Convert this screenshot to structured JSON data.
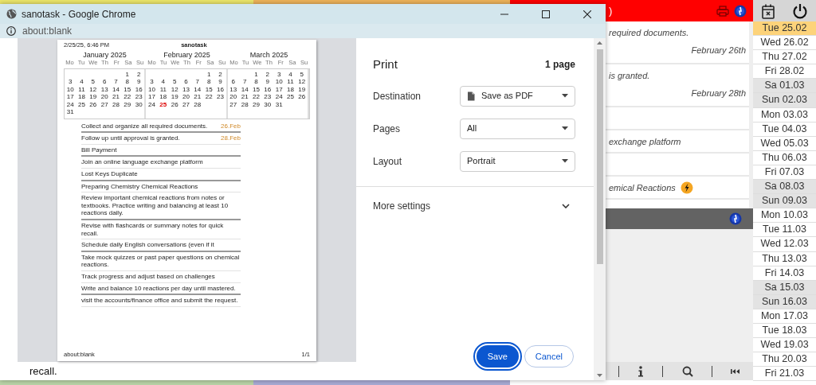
{
  "chrome_window": {
    "title": "sanotask - Google Chrome",
    "address": "about:blank"
  },
  "print_preview": {
    "header_left": "2/25/25, 6:46 PM",
    "header_center": "sanotask",
    "months": [
      {
        "title": "January 2025",
        "weekdays": [
          "Mo",
          "Tu",
          "We",
          "Th",
          "Fr",
          "Sa",
          "Su"
        ],
        "weeks": [
          {
            "right_aligned": true,
            "days": [
              {
                "day": "1",
                "today": false
              },
              {
                "day": "2",
                "today": false
              }
            ]
          },
          {
            "days": [
              {
                "day": "3",
                "today": false
              },
              {
                "day": "4",
                "today": false
              },
              {
                "day": "5",
                "today": false
              },
              {
                "day": "6",
                "today": false
              },
              {
                "day": "7",
                "today": false
              },
              {
                "day": "8",
                "today": false
              },
              {
                "day": "9",
                "today": false
              }
            ]
          },
          {
            "days": [
              {
                "day": "10",
                "today": false
              },
              {
                "day": "11",
                "today": false
              },
              {
                "day": "12",
                "today": false
              },
              {
                "day": "13",
                "today": false
              },
              {
                "day": "14",
                "today": false
              },
              {
                "day": "15",
                "today": false
              },
              {
                "day": "16",
                "today": false
              }
            ]
          },
          {
            "days": [
              {
                "day": "17",
                "today": false
              },
              {
                "day": "18",
                "today": false
              },
              {
                "day": "19",
                "today": false
              },
              {
                "day": "20",
                "today": false
              },
              {
                "day": "21",
                "today": false
              },
              {
                "day": "22",
                "today": false
              },
              {
                "day": "23",
                "today": false
              }
            ]
          },
          {
            "days": [
              {
                "day": "24",
                "today": false
              },
              {
                "day": "25",
                "today": false
              },
              {
                "day": "26",
                "today": false
              },
              {
                "day": "27",
                "today": false
              },
              {
                "day": "28",
                "today": false
              },
              {
                "day": "29",
                "today": false
              },
              {
                "day": "30",
                "today": false
              }
            ]
          },
          {
            "right_aligned": false,
            "days": [
              {
                "day": "31",
                "today": false
              }
            ]
          }
        ]
      },
      {
        "title": "February 2025",
        "weekdays": [
          "Mo",
          "Tu",
          "We",
          "Th",
          "Fr",
          "Sa",
          "Su"
        ],
        "weeks": [
          {
            "right_aligned": true,
            "days": [
              {
                "day": "1",
                "today": false
              },
              {
                "day": "2",
                "today": false
              }
            ]
          },
          {
            "days": [
              {
                "day": "3",
                "today": false
              },
              {
                "day": "4",
                "today": false
              },
              {
                "day": "5",
                "today": false
              },
              {
                "day": "6",
                "today": false
              },
              {
                "day": "7",
                "today": false
              },
              {
                "day": "8",
                "today": false
              },
              {
                "day": "9",
                "today": false
              }
            ]
          },
          {
            "days": [
              {
                "day": "10",
                "today": false
              },
              {
                "day": "11",
                "today": false
              },
              {
                "day": "12",
                "today": false
              },
              {
                "day": "13",
                "today": false
              },
              {
                "day": "14",
                "today": false
              },
              {
                "day": "15",
                "today": false
              },
              {
                "day": "16",
                "today": false
              }
            ]
          },
          {
            "days": [
              {
                "day": "17",
                "today": false
              },
              {
                "day": "18",
                "today": false
              },
              {
                "day": "19",
                "today": false
              },
              {
                "day": "20",
                "today": false
              },
              {
                "day": "21",
                "today": false
              },
              {
                "day": "22",
                "today": false
              },
              {
                "day": "23",
                "today": false
              }
            ]
          },
          {
            "right_aligned": false,
            "days": [
              {
                "day": "24",
                "today": false
              },
              {
                "day": "25",
                "today": true
              },
              {
                "day": "26",
                "today": false
              },
              {
                "day": "27",
                "today": false
              },
              {
                "day": "28",
                "today": false
              }
            ]
          }
        ]
      },
      {
        "title": "March 2025",
        "weekdays": [
          "Mo",
          "Tu",
          "We",
          "Th",
          "Fr",
          "Sa",
          "Su"
        ],
        "weeks": [
          {
            "right_aligned": true,
            "days": [
              {
                "day": "1",
                "today": false
              },
              {
                "day": "2",
                "today": false
              },
              {
                "day": "3",
                "today": false
              },
              {
                "day": "4",
                "today": false
              },
              {
                "day": "5",
                "today": false
              }
            ]
          },
          {
            "days": [
              {
                "day": "6",
                "today": false
              },
              {
                "day": "7",
                "today": false
              },
              {
                "day": "8",
                "today": false
              },
              {
                "day": "9",
                "today": false
              },
              {
                "day": "10",
                "today": false
              },
              {
                "day": "11",
                "today": false
              },
              {
                "day": "12",
                "today": false
              }
            ]
          },
          {
            "days": [
              {
                "day": "13",
                "today": false
              },
              {
                "day": "14",
                "today": false
              },
              {
                "day": "15",
                "today": false
              },
              {
                "day": "16",
                "today": false
              },
              {
                "day": "17",
                "today": false
              },
              {
                "day": "18",
                "today": false
              },
              {
                "day": "19",
                "today": false
              }
            ]
          },
          {
            "days": [
              {
                "day": "20",
                "today": false
              },
              {
                "day": "21",
                "today": false
              },
              {
                "day": "22",
                "today": false
              },
              {
                "day": "23",
                "today": false
              },
              {
                "day": "24",
                "today": false
              },
              {
                "day": "25",
                "today": false
              },
              {
                "day": "26",
                "today": false
              }
            ]
          },
          {
            "right_aligned": false,
            "days": [
              {
                "day": "27",
                "today": false
              },
              {
                "day": "28",
                "today": false
              },
              {
                "day": "29",
                "today": false
              },
              {
                "day": "30",
                "today": false
              },
              {
                "day": "31",
                "today": false
              }
            ]
          }
        ]
      }
    ],
    "tasks": [
      {
        "text": "Collect and organize all required documents.",
        "date": "26.Feb",
        "group_end": true
      },
      {
        "text": "Follow up until approval is granted.",
        "date": "28.Feb",
        "group_end": false
      },
      {
        "text": "Bill Payment",
        "group_end": true
      },
      {
        "text": "Join an online language exchange platform",
        "group_end": false
      },
      {
        "text": "Lost Keys Duplicate",
        "group_end": true
      },
      {
        "text": "Preparing Chemistry Chemical Reactions",
        "group_end": false
      },
      {
        "text": "Review important chemical reactions from notes or textbooks. Practice writing and balancing at least 10 reactions daily.",
        "group_end": true
      },
      {
        "text": "Revise with flashcards or summary notes for quick recall.",
        "group_end": false
      },
      {
        "text": "Schedule daily English conversations (even if it",
        "group_end": true
      },
      {
        "text": "Take mock quizzes or past paper questions on chemical reactions.",
        "group_end": false
      },
      {
        "text": "Track progress and adjust based on challenges",
        "group_end": false
      },
      {
        "text": "Write and balance 10 reactions per day until mastered.",
        "group_end": true
      },
      {
        "text": "visit the accounts/finance office and submit the request.",
        "group_end": false
      }
    ],
    "footer_left": "about:blank",
    "footer_right": "1/1"
  },
  "print_settings": {
    "title": "Print",
    "page_count": "1 page",
    "fields": [
      {
        "label": "Destination",
        "value": "Save as PDF",
        "kind": "destination"
      },
      {
        "label": "Pages",
        "value": "All",
        "kind": "select"
      },
      {
        "label": "Layout",
        "value": "Portrait",
        "kind": "select"
      }
    ],
    "more_settings": "More settings",
    "buttons": [
      {
        "label": "Save",
        "kind": "primary"
      },
      {
        "label": "Cancel",
        "kind": "secondary"
      }
    ]
  },
  "page_behind": {
    "text": "recall."
  },
  "task_panel": {
    "header_title": ")",
    "items": [
      {
        "text": "required documents.",
        "date": "February 26th",
        "flagged": false
      },
      {
        "text": "is granted.",
        "date": "February 28th",
        "flagged": false
      },
      {
        "flagged": false
      },
      {
        "text": "exchange platform",
        "flagged": false
      },
      {
        "flagged": false
      },
      {
        "text": "emical Reactions",
        "flagged": true
      }
    ]
  },
  "date_list": [
    {
      "label": "Tue 25.02",
      "selected": true,
      "weekend": false
    },
    {
      "label": "Wed 26.02",
      "selected": false,
      "weekend": false
    },
    {
      "label": "Thu 27.02",
      "selected": false,
      "weekend": false
    },
    {
      "label": "Fri 28.02",
      "selected": false,
      "weekend": false
    },
    {
      "label": "Sa 01.03",
      "selected": false,
      "weekend": true
    },
    {
      "label": "Sun 02.03",
      "selected": false,
      "weekend": true
    },
    {
      "label": "Mon 03.03",
      "selected": false,
      "weekend": false
    },
    {
      "label": "Tue 04.03",
      "selected": false,
      "weekend": false
    },
    {
      "label": "Wed 05.03",
      "selected": false,
      "weekend": false
    },
    {
      "label": "Thu 06.03",
      "selected": false,
      "weekend": false
    },
    {
      "label": "Fri 07.03",
      "selected": false,
      "weekend": false
    },
    {
      "label": "Sa 08.03",
      "selected": false,
      "weekend": true
    },
    {
      "label": "Sun 09.03",
      "selected": false,
      "weekend": true
    },
    {
      "label": "Mon 10.03",
      "selected": false,
      "weekend": false
    },
    {
      "label": "Tue 11.03",
      "selected": false,
      "weekend": false
    },
    {
      "label": "Wed 12.03",
      "selected": false,
      "weekend": false
    },
    {
      "label": "Thu 13.03",
      "selected": false,
      "weekend": false
    },
    {
      "label": "Fri 14.03",
      "selected": false,
      "weekend": false
    },
    {
      "label": "Sa 15.03",
      "selected": false,
      "weekend": true
    },
    {
      "label": "Sun 16.03",
      "selected": false,
      "weekend": true
    },
    {
      "label": "Mon 17.03",
      "selected": false,
      "weekend": false
    },
    {
      "label": "Tue 18.03",
      "selected": false,
      "weekend": false
    },
    {
      "label": "Wed 19.03",
      "selected": false,
      "weekend": false
    },
    {
      "label": "Thu 20.03",
      "selected": false,
      "weekend": false
    },
    {
      "label": "Fri 21.03",
      "selected": false,
      "weekend": false
    }
  ]
}
